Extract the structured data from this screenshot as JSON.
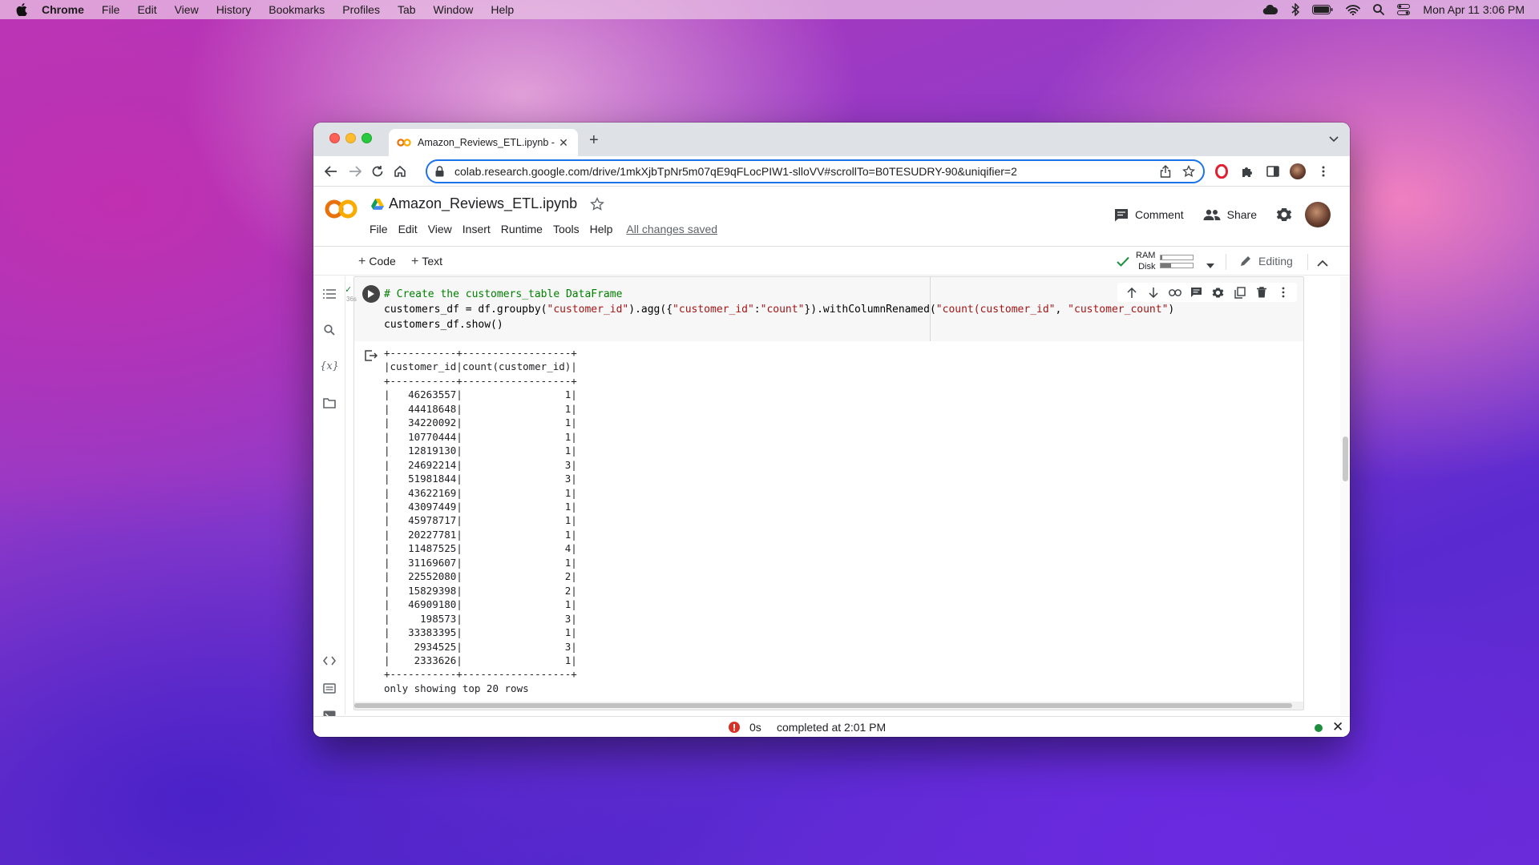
{
  "menubar": {
    "app": "Chrome",
    "items": [
      "File",
      "Edit",
      "View",
      "History",
      "Bookmarks",
      "Profiles",
      "Tab",
      "Window",
      "Help"
    ],
    "clock": "Mon Apr 11  3:06 PM"
  },
  "browser": {
    "tab_title": "Amazon_Reviews_ETL.ipynb - ",
    "url": "colab.research.google.com/drive/1mkXjbTpNr5m07qE9qFLocPIW1-slloVV#scrollTo=B0TESUDRY-90&uniqifier=2"
  },
  "colab": {
    "logo": "CO",
    "notebook_title": "Amazon_Reviews_ETL.ipynb",
    "menu": [
      "File",
      "Edit",
      "View",
      "Insert",
      "Runtime",
      "Tools",
      "Help"
    ],
    "save_status": "All changes saved",
    "comment_label": "Comment",
    "share_label": "Share",
    "add_code_label": "Code",
    "add_text_label": "Text",
    "ram_label": "RAM",
    "disk_label": "Disk",
    "editing_label": "Editing",
    "ram_usage": 0.05,
    "disk_usage": 0.32
  },
  "cell": {
    "exec_mark": "✓",
    "exec_time": "36s",
    "code_line1": "# Create the customers_table DataFrame",
    "code_line2_a": "customers_df = df.groupby(",
    "code_line2_s1": "\"customer_id\"",
    "code_line2_b": ").agg({",
    "code_line2_s2": "\"customer_id\"",
    "code_line2_c": ":",
    "code_line2_s3": "\"count\"",
    "code_line2_d": "}).withColumnRenamed(",
    "code_line2_s4": "\"count(customer_id\"",
    "code_line2_e": ", ",
    "code_line2_s5": "\"customer_count\"",
    "code_line2_f": ")",
    "code_line3": "customers_df.show()",
    "output": "+-----------+------------------+\n|customer_id|count(customer_id)|\n+-----------+------------------+\n|   46263557|                 1|\n|   44418648|                 1|\n|   34220092|                 1|\n|   10770444|                 1|\n|   12819130|                 1|\n|   24692214|                 3|\n|   51981844|                 3|\n|   43622169|                 1|\n|   43097449|                 1|\n|   45978717|                 1|\n|   20227781|                 1|\n|   11487525|                 4|\n|   31169607|                 1|\n|   22552080|                 2|\n|   15829398|                 2|\n|   46909180|                 1|\n|     198573|                 3|\n|   33383395|                 1|\n|    2934525|                 3|\n|    2333626|                 1|\n+-----------+------------------+\nonly showing top 20 rows"
  },
  "status": {
    "seconds": "0s",
    "completed": "completed at 2:01 PM"
  },
  "colors": {
    "accent": "#1a73e8",
    "colab_orange": "#f9ab00",
    "ok_green": "#1e8e3e",
    "error_red": "#d93025"
  }
}
